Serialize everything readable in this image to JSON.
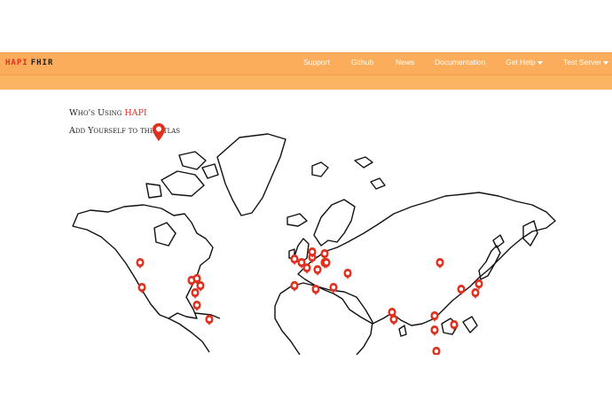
{
  "brand": {
    "hapi": "HAPI",
    "fhir": "FHIR"
  },
  "nav": {
    "items": [
      {
        "label": "Support",
        "dropdown": false
      },
      {
        "label": "Github",
        "dropdown": false
      },
      {
        "label": "News",
        "dropdown": false
      },
      {
        "label": "Documentation",
        "dropdown": false
      },
      {
        "label": "Get Help",
        "dropdown": true
      },
      {
        "label": "Test Server",
        "dropdown": true
      }
    ]
  },
  "atlas": {
    "title_prefix": "Who's Using",
    "title_accent": "HAPI",
    "add_link": "Add Yourself to the Atlas",
    "pin_icon": "map-marker-icon"
  },
  "colors": {
    "navbar": "#fbad5b",
    "accent": "#e0301e",
    "marker": "#e0301e"
  }
}
